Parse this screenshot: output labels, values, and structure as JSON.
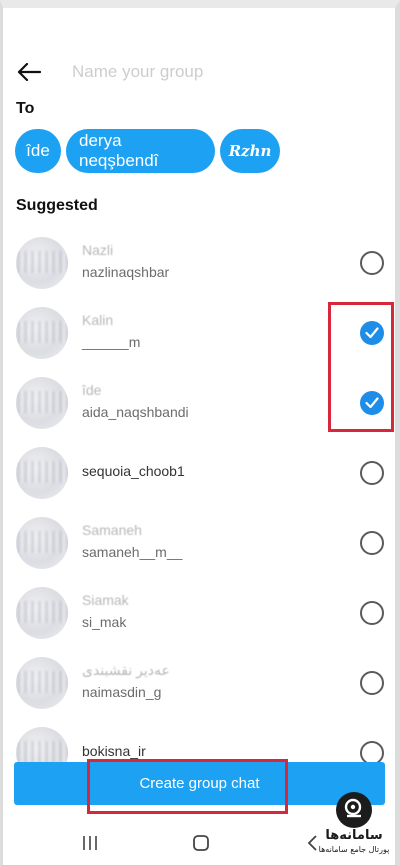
{
  "header": {
    "name_placeholder": "Name your group"
  },
  "to_label": "To",
  "selected_chips": [
    "îde",
    "derya neqşbendî",
    "Rzhn"
  ],
  "suggested_label": "Suggested",
  "suggested": [
    {
      "name": "Nazli",
      "username": "nazlinaqshbar",
      "checked": false
    },
    {
      "name": "Kalin",
      "username": "______m",
      "checked": true
    },
    {
      "name": "îde",
      "username": "aida_naqshbandi",
      "checked": true
    },
    {
      "name": "",
      "username": "sequoia_choob1",
      "checked": false
    },
    {
      "name": "Samaneh",
      "username": "samaneh__m__",
      "checked": false
    },
    {
      "name": "Siamak",
      "username": "si_mak",
      "checked": false
    },
    {
      "name": "عه‌دیر نقشبندی",
      "username": "naimasdin_g",
      "checked": false
    },
    {
      "name": "",
      "username": "bokisna_ir",
      "checked": false
    }
  ],
  "create_button_label": "Create group chat",
  "watermark": {
    "title": "سامانه‌ها",
    "subtitle": "پورتال جامع سامانه‌ها"
  }
}
